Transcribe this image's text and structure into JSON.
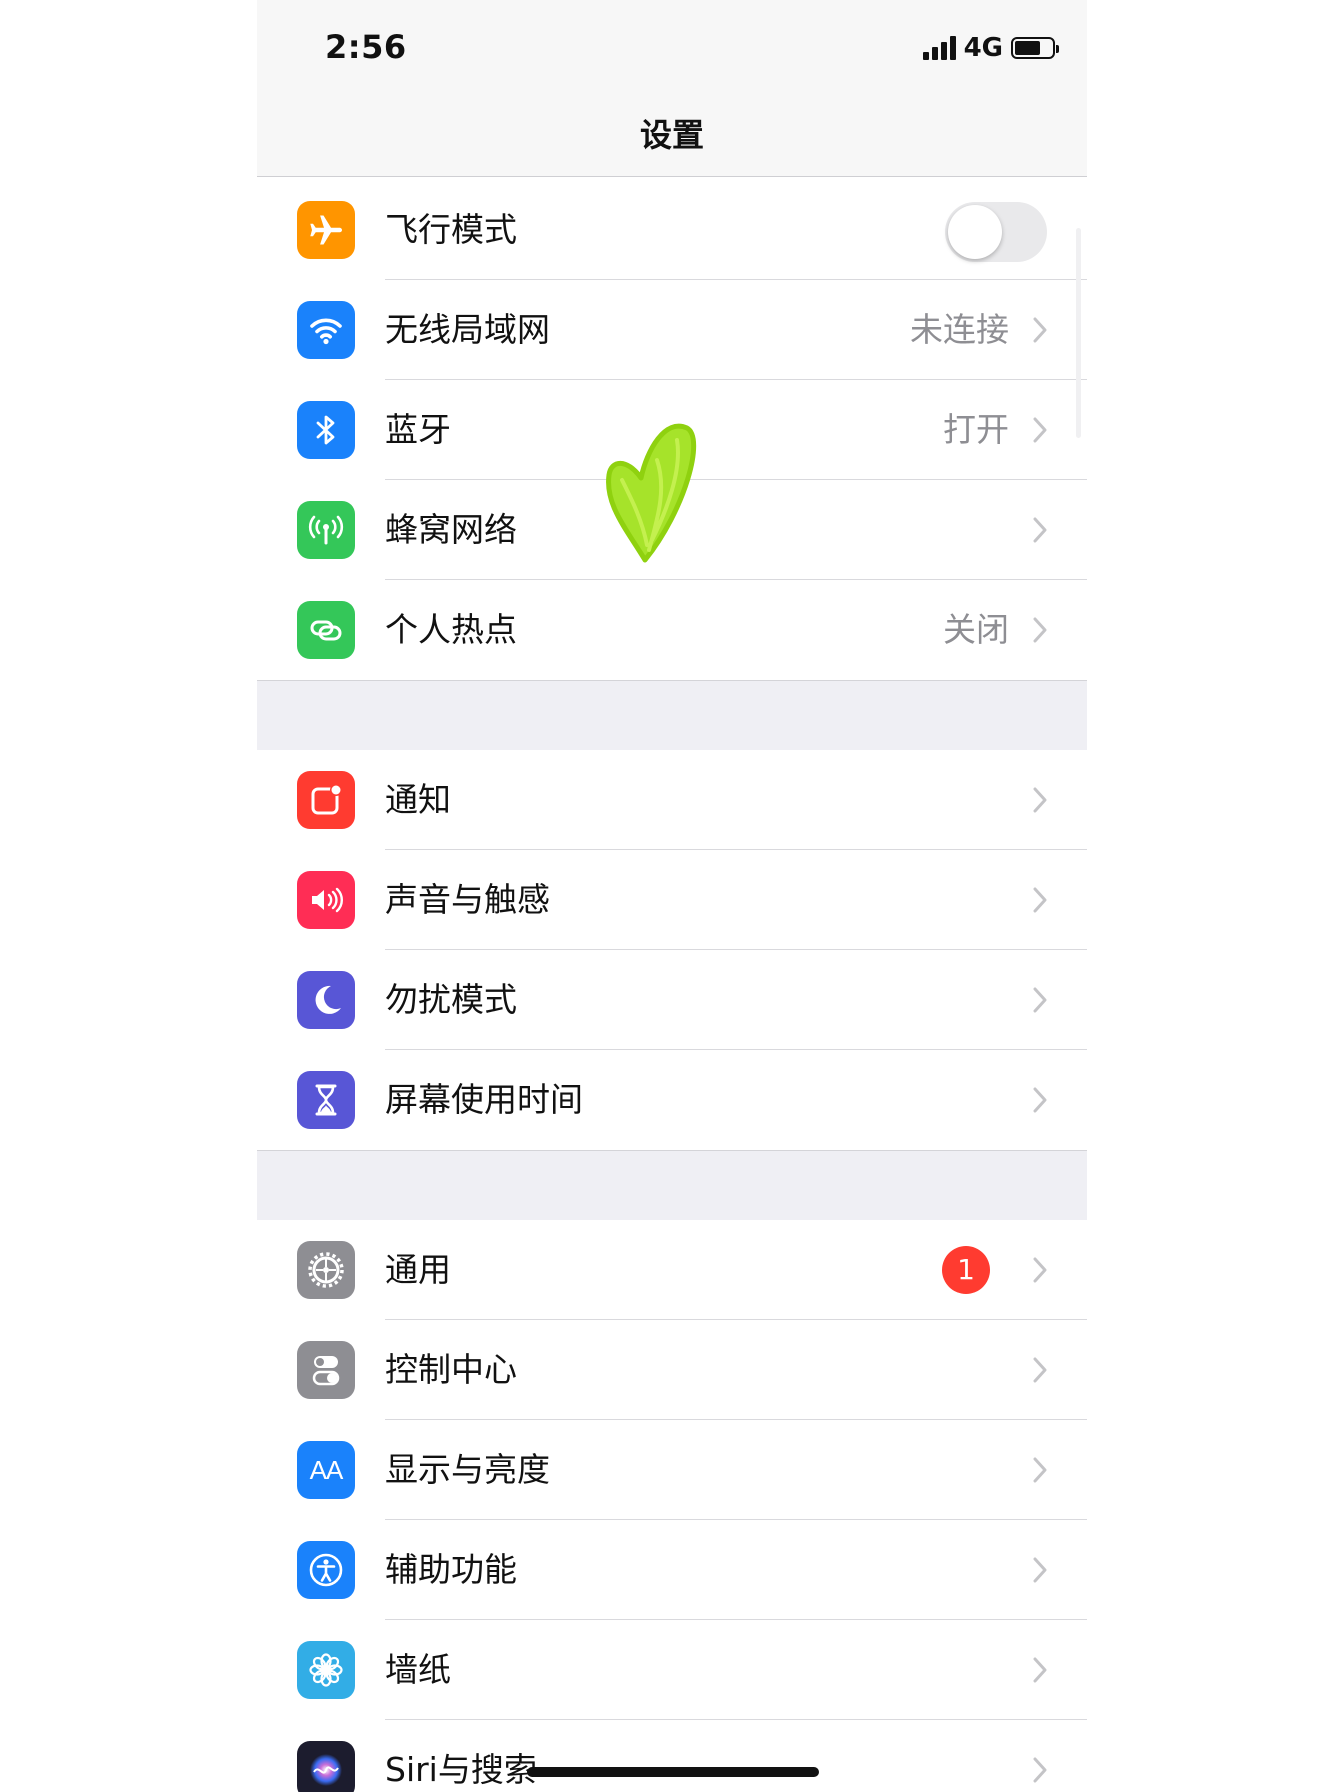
{
  "status_bar": {
    "time": "2:56",
    "network": "4G",
    "battery_level": 0.7
  },
  "header": {
    "title": "设置"
  },
  "colors": {
    "orange": "#ff9500",
    "blue": "#1a82fb",
    "green": "#34c759",
    "red": "#ff3b30",
    "pink": "#ff2d55",
    "indigo": "#5856d6",
    "gray": "#8e8e93",
    "teal": "#32ade6"
  },
  "groups": [
    {
      "rows": [
        {
          "label": "飞行模式",
          "icon": "airplane-icon",
          "toggle": false
        },
        {
          "label": "无线局域网",
          "icon": "wifi-icon",
          "value": "未连接"
        },
        {
          "label": "蓝牙",
          "icon": "bluetooth-icon",
          "value": "打开"
        },
        {
          "label": "蜂窝网络",
          "icon": "cellular-antenna-icon",
          "value": ""
        },
        {
          "label": "个人热点",
          "icon": "hotspot-icon",
          "value": "关闭"
        }
      ]
    },
    {
      "rows": [
        {
          "label": "通知",
          "icon": "notifications-icon"
        },
        {
          "label": "声音与触感",
          "icon": "speaker-icon"
        },
        {
          "label": "勿扰模式",
          "icon": "moon-icon"
        },
        {
          "label": "屏幕使用时间",
          "icon": "hourglass-icon"
        }
      ]
    },
    {
      "rows": [
        {
          "label": "通用",
          "icon": "gear-icon",
          "badge": "1"
        },
        {
          "label": "控制中心",
          "icon": "switches-icon"
        },
        {
          "label": "显示与亮度",
          "icon": "text-size-icon",
          "icon_text": "AA"
        },
        {
          "label": "辅助功能",
          "icon": "accessibility-icon"
        },
        {
          "label": "墙纸",
          "icon": "flower-icon"
        },
        {
          "label": "Siri与搜索",
          "icon": "siri-icon"
        }
      ]
    }
  ]
}
